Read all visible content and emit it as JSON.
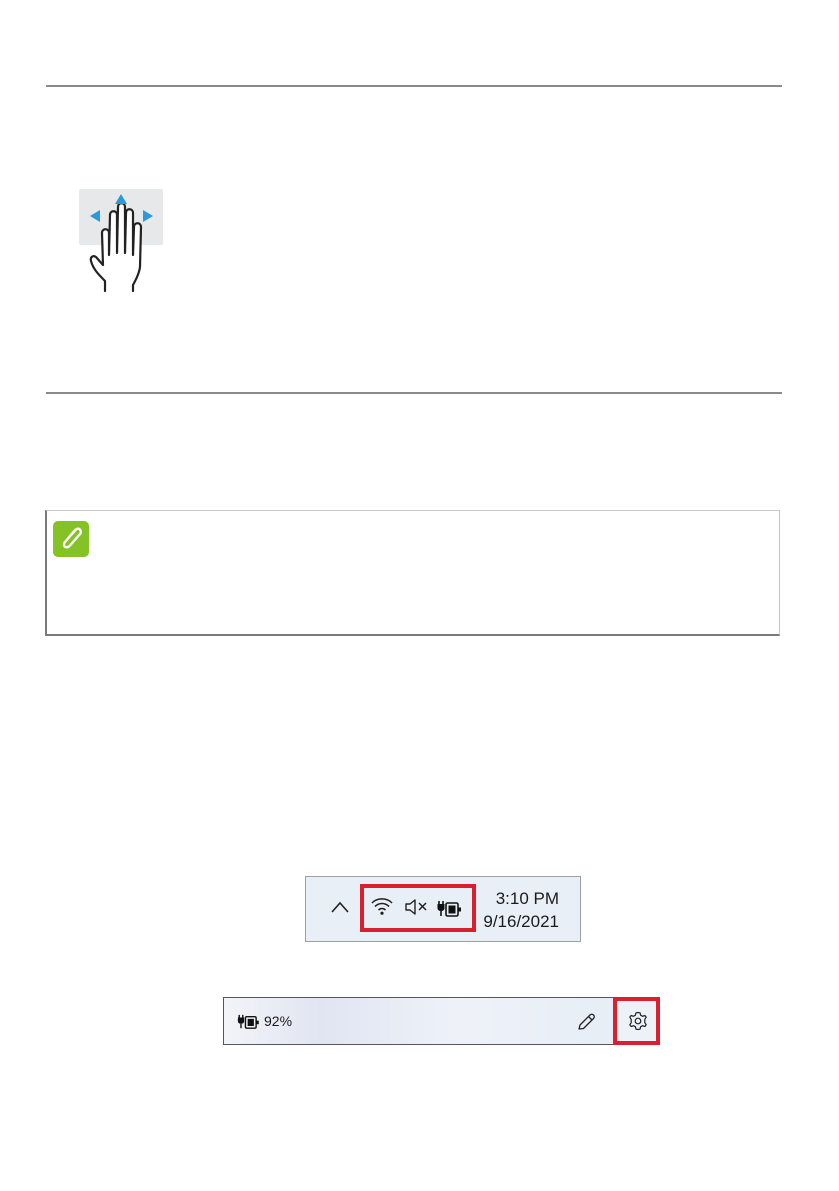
{
  "gesture": {
    "icon": "three-finger-swipe-icon"
  },
  "note": {
    "icon": "paperclip-icon",
    "accent": "#84c225"
  },
  "tray": {
    "icons": [
      "chevron-up-icon",
      "wifi-icon",
      "speaker-muted-icon",
      "battery-charging-icon"
    ],
    "time": "3:10 PM",
    "date": "9/16/2021",
    "highlight_color": "#d9202f"
  },
  "quick_settings": {
    "battery_icon": "battery-charging-icon",
    "battery_text": "92%",
    "edit_icon": "pencil-icon",
    "settings_icon": "gear-icon",
    "highlight_color": "#d9202f"
  }
}
